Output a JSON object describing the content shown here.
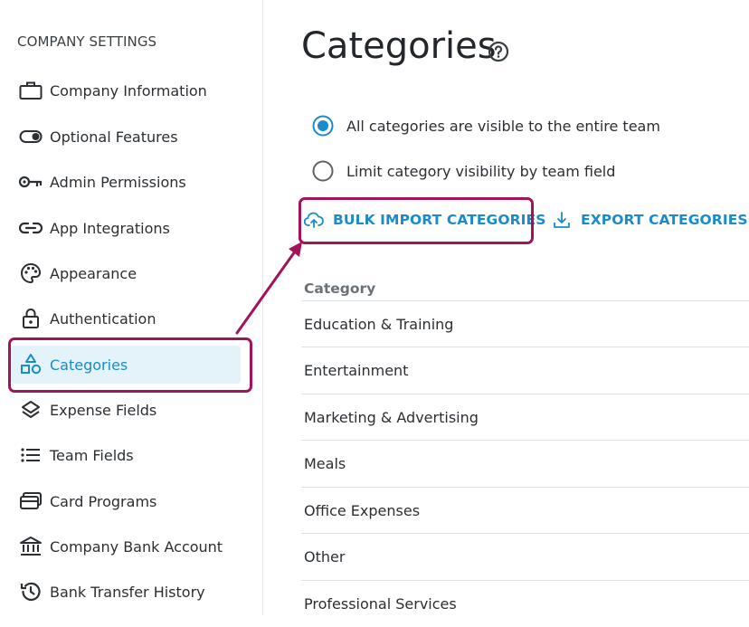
{
  "sidebar": {
    "section_title": "COMPANY SETTINGS",
    "items": [
      {
        "label": "Company Information",
        "icon": "briefcase-icon"
      },
      {
        "label": "Optional Features",
        "icon": "toggle-icon"
      },
      {
        "label": "Admin Permissions",
        "icon": "key-icon"
      },
      {
        "label": "App Integrations",
        "icon": "link-icon"
      },
      {
        "label": "Appearance",
        "icon": "palette-icon"
      },
      {
        "label": "Authentication",
        "icon": "lock-icon"
      },
      {
        "label": "Categories",
        "icon": "shapes-icon",
        "active": true
      },
      {
        "label": "Expense Fields",
        "icon": "layers-icon"
      },
      {
        "label": "Team Fields",
        "icon": "list-icon"
      },
      {
        "label": "Card Programs",
        "icon": "cards-icon"
      },
      {
        "label": "Company Bank Account",
        "icon": "bank-icon"
      },
      {
        "label": "Bank Transfer History",
        "icon": "history-icon"
      }
    ]
  },
  "main": {
    "title": "Categories",
    "visibility_options": [
      {
        "label": "All categories are visible to the entire team",
        "selected": true
      },
      {
        "label": "Limit category visibility by team field",
        "selected": false
      }
    ],
    "bulk_import_label": "BULK IMPORT CATEGORIES",
    "export_label": "EXPORT CATEGORIES",
    "column_header": "Category",
    "categories": [
      "Education & Training",
      "Entertainment",
      "Marketing & Advertising",
      "Meals",
      "Office Expenses",
      "Other",
      "Professional Services"
    ]
  },
  "colors": {
    "accent": "#1a8ccb",
    "active_bg": "#e4f2fa",
    "annotation": "#a3135b"
  }
}
